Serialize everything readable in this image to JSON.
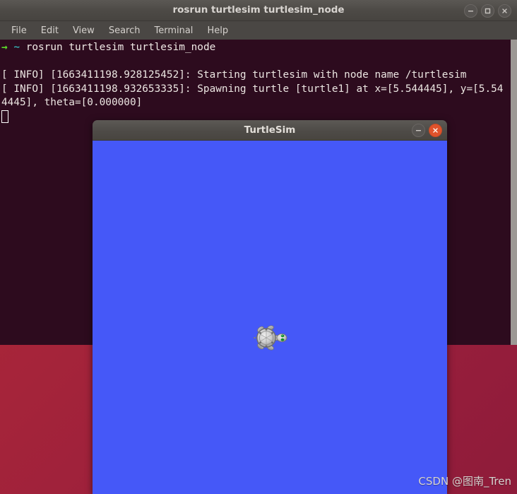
{
  "terminal": {
    "title": "rosrun turtlesim turtlesim_node",
    "menu": [
      {
        "label": "File"
      },
      {
        "label": "Edit"
      },
      {
        "label": "View"
      },
      {
        "label": "Search"
      },
      {
        "label": "Terminal"
      },
      {
        "label": "Help"
      }
    ],
    "window_buttons": {
      "minimize": "minimize",
      "maximize": "maximize",
      "close": "close"
    },
    "prompt": {
      "arrow": "→",
      "path": "~",
      "command": "rosrun turtlesim turtlesim_node"
    },
    "output": [
      "[ INFO] [1663411198.928125452]: Starting turtlesim with node name /turtlesim",
      "[ INFO] [1663411198.932653335]: Spawning turtle [turtle1] at x=[5.544445], y=[5.544445], theta=[0.000000]"
    ]
  },
  "turtlesim": {
    "title": "TurtleSim",
    "window_buttons": {
      "minimize": "minimize",
      "close": "close"
    },
    "canvas": {
      "background_color": "#4558f8",
      "turtle": {
        "name": "turtle1",
        "x": "5.544445",
        "y": "5.544445",
        "theta": "0.000000"
      }
    }
  },
  "desktop": {
    "wallpaper_color": "#a5243a"
  },
  "watermark": {
    "text": "CSDN @图南_Tren"
  }
}
